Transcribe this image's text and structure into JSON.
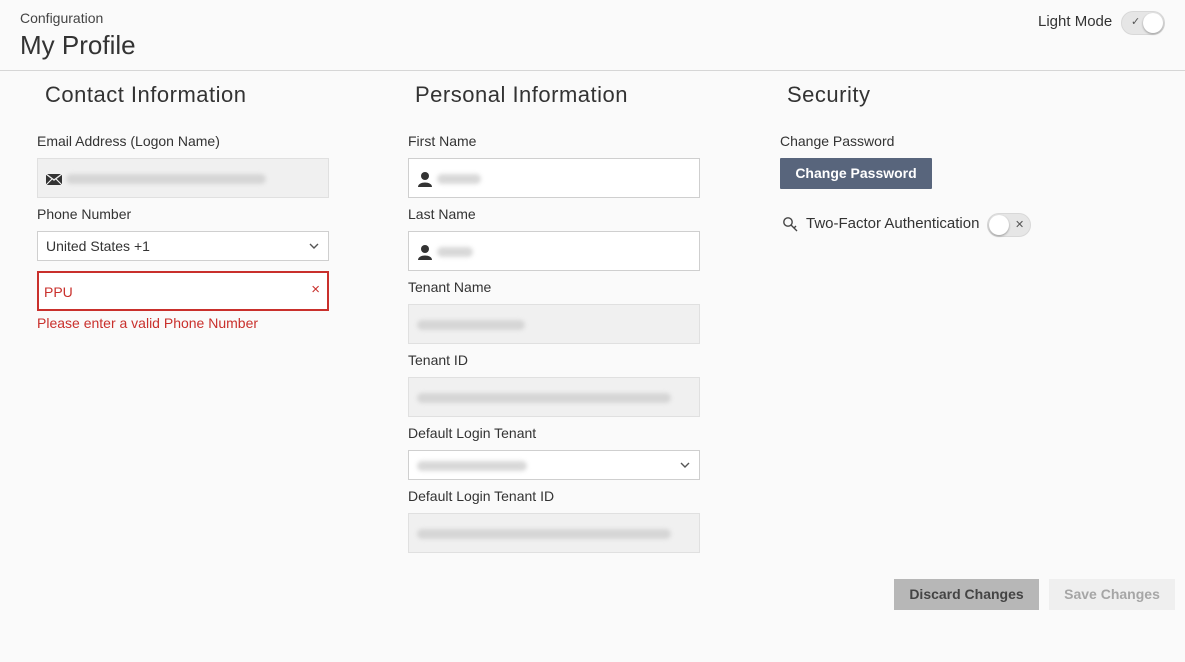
{
  "header": {
    "breadcrumb": "Configuration",
    "title": "My Profile",
    "mode_label": "Light Mode",
    "mode_on": true
  },
  "contact": {
    "title": "Contact Information",
    "email_label": "Email Address (Logon Name)",
    "phone_label": "Phone Number",
    "country_code": "United States +1",
    "phone_value": "PPU",
    "phone_error": "Please enter a valid Phone Number",
    "clear_icon": "×"
  },
  "personal": {
    "title": "Personal Information",
    "first_name_label": "First Name",
    "last_name_label": "Last Name",
    "tenant_name_label": "Tenant Name",
    "tenant_id_label": "Tenant ID",
    "default_tenant_label": "Default Login Tenant",
    "default_tenant_id_label": "Default Login Tenant ID"
  },
  "security": {
    "title": "Security",
    "change_password_label": "Change Password",
    "change_password_button": "Change Password",
    "two_factor_label": "Two-Factor Authentication",
    "two_factor_on": false
  },
  "footer": {
    "discard_label": "Discard Changes",
    "save_label": "Save Changes"
  },
  "icons": {
    "email": "envelope-icon",
    "person": "person-icon",
    "key": "key-icon",
    "chevron": "chevron-down-icon",
    "check": "✓",
    "x": "✕"
  },
  "colors": {
    "primary_button": "#58657c",
    "error": "#c9302c",
    "discard_button": "#b7b7b7"
  }
}
